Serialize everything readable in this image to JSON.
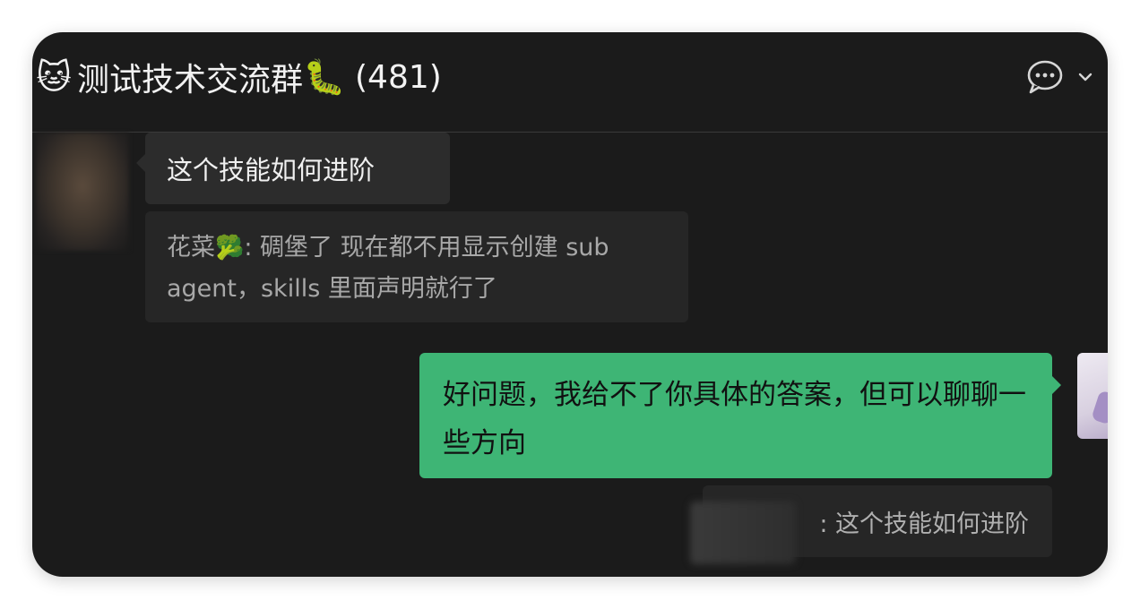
{
  "header": {
    "leading_emoji": "🐱",
    "group_name": "测试技术交流群",
    "trailing_emoji": "🐛",
    "member_count": "(481)"
  },
  "messages": [
    {
      "side": "left",
      "text": "这个技能如何进阶"
    },
    {
      "side": "left-quote",
      "author": "花菜",
      "author_emoji": "🥦",
      "text": ": 碉堡了 现在都不用显示创建 sub agent，skills 里面声明就行了"
    },
    {
      "side": "right",
      "text": "好问题，我给不了你具体的答案，但可以聊聊一些方向"
    },
    {
      "side": "right-quote",
      "text": ": 这个技能如何进阶"
    }
  ],
  "icons": {
    "header_chat": "chat-bubble-icon",
    "header_dropdown": "chevron-down-icon"
  },
  "colors": {
    "window_bg": "#1b1b1b",
    "incoming_bubble": "#2c2c2c",
    "outgoing_bubble": "#3eb575",
    "quote_bg": "#262626"
  }
}
